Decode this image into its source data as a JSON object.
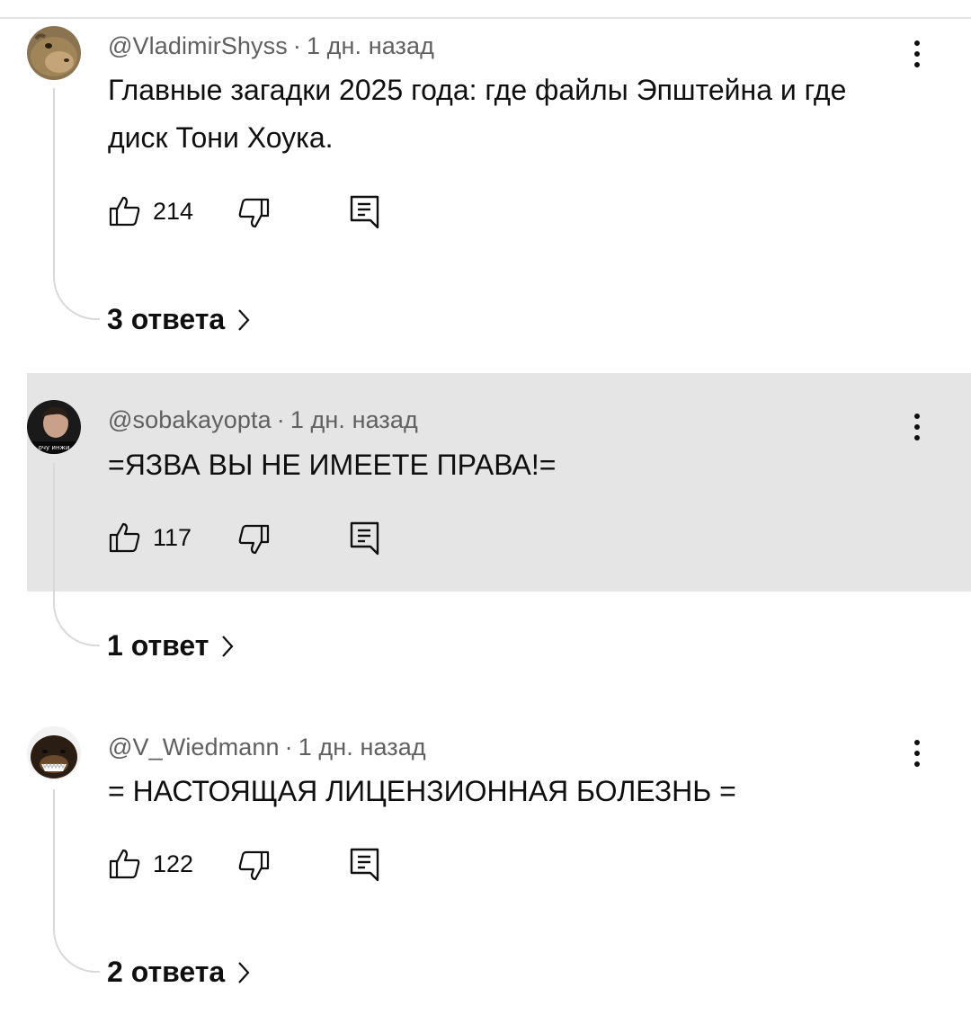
{
  "comments": [
    {
      "author": "@VladimirShyss",
      "separator": "·",
      "time": "1 дн. назад",
      "text": "Главные загадки 2025 года: где файлы Эпштейна и где диск Тони Хоука.",
      "likes": "214",
      "replies_label": "3 ответа",
      "avatar": "capybara-avatar",
      "highlighted": false
    },
    {
      "author": "@sobakayopta",
      "separator": "·",
      "time": "1 дн. назад",
      "text": "=ЯЗВА ВЫ НЕ ИМЕЕТЕ ПРАВА!=",
      "likes": "117",
      "replies_label": "1 ответ",
      "avatar": "person-avatar",
      "avatar_caption": "очу инжи",
      "highlighted": true
    },
    {
      "author": "@V_Wiedmann",
      "separator": "·",
      "time": "1 дн. назад",
      "text": "= НАСТОЯЩАЯ ЛИЦЕНЗИОННАЯ БОЛЕЗНЬ =",
      "likes": "122",
      "replies_label": "2 ответа",
      "avatar": "dog-avatar",
      "highlighted": false
    }
  ],
  "icons": {
    "like": "thumbs-up-icon",
    "dislike": "thumbs-down-icon",
    "reply": "reply-comment-icon",
    "more": "more-vertical-icon",
    "chevron": "chevron-right-icon"
  },
  "colors": {
    "highlight_bg": "#e5e5e5",
    "meta_text": "#606060",
    "text": "#0f0f0f",
    "thread_line": "#d9d9d9"
  }
}
